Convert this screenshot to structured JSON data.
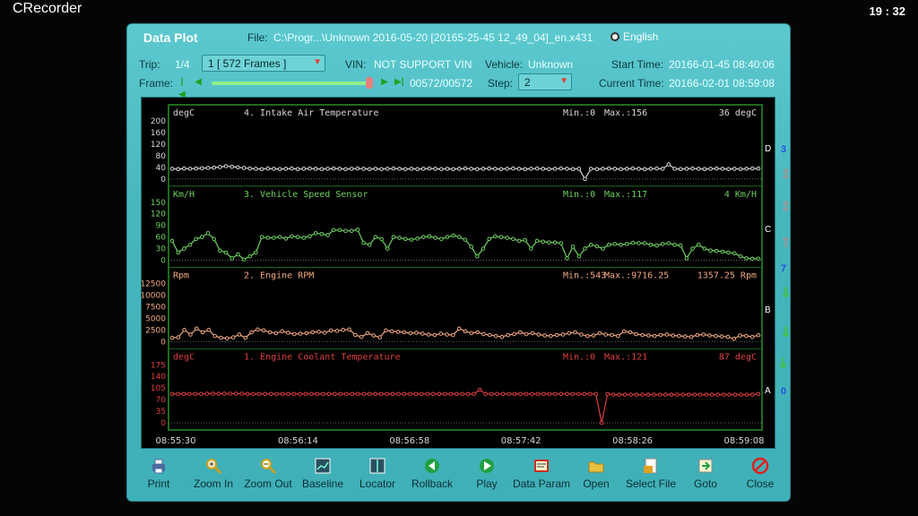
{
  "app": {
    "title": "CRecorder",
    "clock": "19 : 32"
  },
  "dialog": {
    "title": "Data Plot",
    "file_label": "File:",
    "file_value": "C:\\Progr...\\Unknown 2016-05-20 [20165-25-45 12_49_04]_en.x431",
    "language": "English",
    "trip_label": "Trip:",
    "trip_value": "1/4",
    "trip_select": "1  [   572 Frames ]",
    "vin_label": "VIN:",
    "vin_value": "NOT SUPPORT VIN",
    "vehicle_label": "Vehicle:",
    "vehicle_value": "Unknown",
    "start_label": "Start Time:",
    "start_value": "20166-01-45 08:40:06",
    "frame_label": "Frame:",
    "frame_value": "00572/00572",
    "frame_progress": 1.0,
    "step_label": "Step:",
    "step_value": "2",
    "current_label": "Current Time:",
    "current_value": "20166-02-01 08:59:08"
  },
  "side": {
    "top_num": "3",
    "mid_num": "7",
    "bot_num": "0",
    "letters": [
      "D",
      "C",
      "B",
      "A"
    ]
  },
  "chart_data": {
    "type": "line",
    "x_ticks": [
      "08:55:30",
      "08:56:14",
      "08:56:58",
      "08:57:42",
      "08:58:26",
      "08:59:08"
    ],
    "panels": [
      {
        "title": "4. Intake Air Temperature",
        "unit": "degC",
        "min": "Min.:0",
        "max": "Max.:156",
        "current": "36  degC",
        "color": "#d8d8d8",
        "ylim": [
          0,
          200
        ],
        "ticks": [
          "200",
          "160",
          "120",
          "80",
          "40",
          "0"
        ],
        "values": [
          35,
          34,
          36,
          35,
          36,
          37,
          38,
          39,
          41,
          44,
          42,
          40,
          38,
          36,
          35,
          34,
          36,
          35,
          34,
          35,
          36,
          34,
          35,
          36,
          35,
          34,
          35,
          36,
          35,
          34,
          35,
          36,
          35,
          34,
          35,
          34,
          35,
          36,
          35,
          34,
          35,
          34,
          35,
          36,
          35,
          34,
          35,
          34,
          35,
          36,
          35,
          34,
          35,
          36,
          35,
          34,
          35,
          36,
          35,
          34,
          35,
          36,
          35,
          34,
          35,
          36,
          35,
          34,
          35,
          0,
          35,
          34,
          35,
          36,
          35,
          34,
          35,
          36,
          35,
          34,
          35,
          36,
          35,
          50,
          35,
          34,
          35,
          36,
          35,
          34,
          35,
          36,
          35,
          34,
          35,
          34,
          35,
          36,
          36
        ]
      },
      {
        "title": "3. Vehicle Speed Sensor",
        "unit": "Km/H",
        "min": "Min.:0",
        "max": "Max.:117",
        "current": "4  Km/H",
        "color": "#6fd060",
        "ylim": [
          0,
          150
        ],
        "ticks": [
          "150",
          "120",
          "90",
          "60",
          "30",
          "0"
        ],
        "values": [
          50,
          20,
          30,
          40,
          55,
          60,
          70,
          55,
          25,
          20,
          5,
          15,
          2,
          10,
          20,
          60,
          58,
          58,
          60,
          56,
          62,
          60,
          58,
          62,
          70,
          68,
          65,
          78,
          78,
          76,
          76,
          79,
          45,
          40,
          60,
          55,
          30,
          60,
          58,
          55,
          53,
          56,
          60,
          62,
          58,
          55,
          60,
          64,
          60,
          53,
          35,
          10,
          30,
          55,
          62,
          60,
          58,
          55,
          50,
          52,
          30,
          50,
          48,
          46,
          46,
          44,
          5,
          35,
          10,
          30,
          40,
          36,
          30,
          40,
          42,
          40,
          42,
          45,
          44,
          44,
          40,
          38,
          42,
          44,
          40,
          38,
          5,
          30,
          40,
          30,
          25,
          24,
          22,
          20,
          18,
          10,
          5,
          4,
          4
        ]
      },
      {
        "title": "2. Engine RPM",
        "unit": "Rpm",
        "min": "Min.:543",
        "max": "Max.:9716.25",
        "current": "1357.25  Rpm",
        "color": "#f0a880",
        "ylim": [
          0,
          12500
        ],
        "ticks": [
          "12500",
          "10000",
          "7500",
          "5000",
          "2500",
          "0"
        ],
        "values": [
          800,
          900,
          2500,
          1500,
          2800,
          2000,
          2500,
          1200,
          800,
          700,
          900,
          1500,
          800,
          2000,
          2600,
          2400,
          2000,
          1800,
          2200,
          1900,
          1600,
          1700,
          1800,
          2000,
          2100,
          1900,
          2400,
          2300,
          2500,
          2600,
          1400,
          1000,
          1800,
          1300,
          900,
          2400,
          2200,
          2100,
          2000,
          1800,
          1900,
          1700,
          1500,
          1400,
          1700,
          1500,
          1400,
          2800,
          2200,
          1800,
          2000,
          1600,
          1400,
          1200,
          1000,
          1400,
          1600,
          2000,
          1600,
          1800,
          1500,
          1300,
          1200,
          1400,
          1500,
          1800,
          2000,
          1500,
          1200,
          1300,
          1800,
          1500,
          1400,
          1200,
          2200,
          2000,
          1600,
          1400,
          1300,
          1200,
          1400,
          1500,
          1300,
          1200,
          1100,
          1000,
          1400,
          1500,
          1300,
          1200,
          1100,
          1000,
          600,
          1300,
          1200,
          1000,
          1357
        ]
      },
      {
        "title": "1. Engine Coolant Temperature",
        "unit": "degC",
        "min": "Min.:0",
        "max": "Max.:121",
        "current": "87  degC",
        "color": "#e04040",
        "ylim": [
          0,
          175
        ],
        "ticks": [
          "175",
          "140",
          "105",
          "70",
          "35",
          "0"
        ],
        "values": [
          87,
          87,
          87,
          87,
          87,
          87,
          88,
          88,
          88,
          88,
          88,
          88,
          88,
          87,
          87,
          87,
          87,
          87,
          87,
          87,
          87,
          87,
          87,
          87,
          87,
          87,
          87,
          87,
          87,
          87,
          87,
          87,
          87,
          87,
          87,
          87,
          87,
          87,
          87,
          87,
          87,
          87,
          87,
          87,
          87,
          87,
          87,
          87,
          87,
          87,
          87,
          87,
          87,
          100,
          87,
          87,
          87,
          87,
          87,
          87,
          87,
          87,
          87,
          87,
          87,
          87,
          87,
          87,
          87,
          87,
          87,
          87,
          87,
          87,
          0,
          87,
          85,
          85,
          85,
          85,
          85,
          85,
          85,
          85,
          85,
          85,
          85,
          85,
          85,
          85,
          85,
          85,
          85,
          85,
          85,
          85,
          85,
          85,
          85,
          85,
          85,
          87
        ]
      }
    ]
  },
  "toolbar": [
    {
      "label": "Print",
      "icon": "printer-icon",
      "color": "#4a6aa0"
    },
    {
      "label": "Zoom In",
      "icon": "zoom-in-icon",
      "color": "#c8a020"
    },
    {
      "label": "Zoom Out",
      "icon": "zoom-out-icon",
      "color": "#c8a020"
    },
    {
      "label": "Baseline",
      "icon": "baseline-icon",
      "color": "#2a5060"
    },
    {
      "label": "Locator",
      "icon": "locator-icon",
      "color": "#2a5060"
    },
    {
      "label": "Rollback",
      "icon": "rollback-icon",
      "color": "#20a040"
    },
    {
      "label": "Play",
      "icon": "play-icon",
      "color": "#20a040"
    },
    {
      "label": "Data Param",
      "icon": "data-param-icon",
      "color": "#e0a020"
    },
    {
      "label": "Open",
      "icon": "folder-icon",
      "color": "#e8c040"
    },
    {
      "label": "Select File",
      "icon": "select-file-icon",
      "color": "#e0a020"
    },
    {
      "label": "Goto",
      "icon": "goto-icon",
      "color": "#e0a020"
    },
    {
      "label": "Close",
      "icon": "close-icon",
      "color": "#e02020"
    }
  ]
}
